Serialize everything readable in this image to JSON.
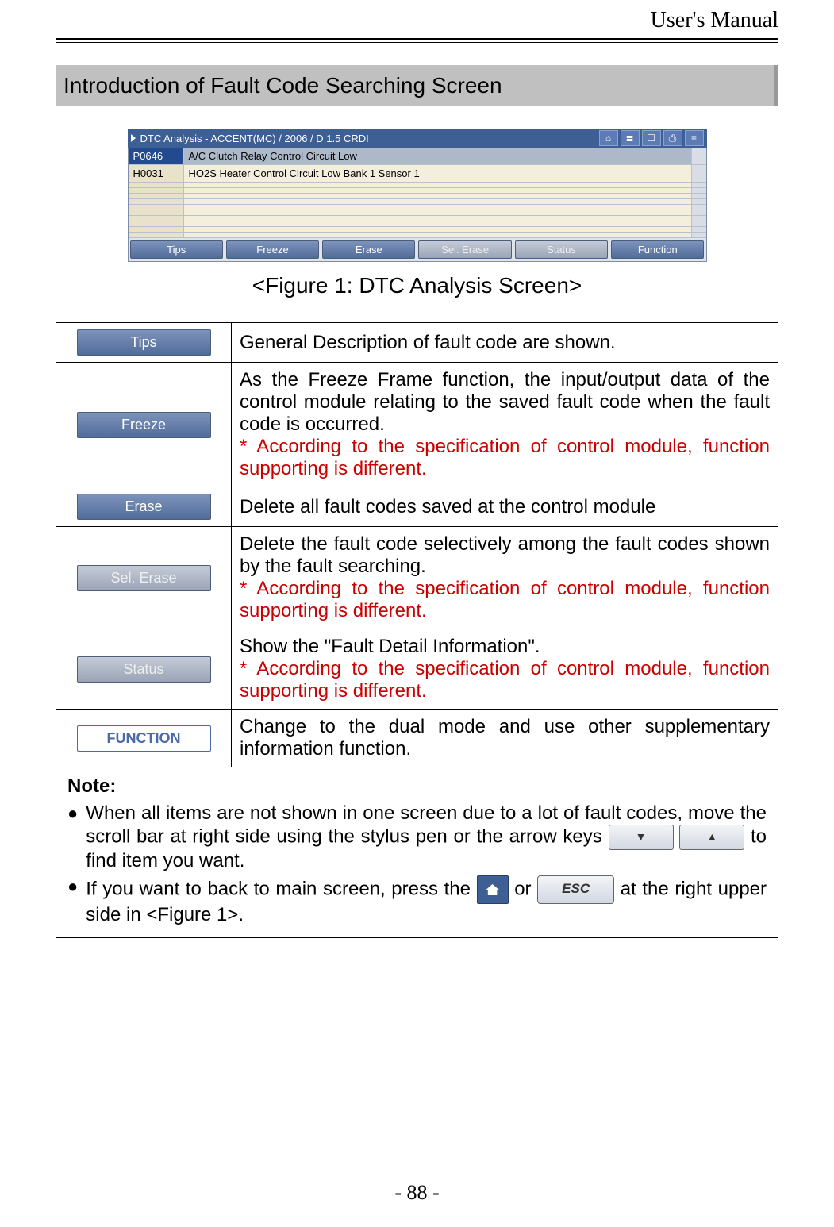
{
  "header": "User's Manual",
  "section_title": "Introduction of Fault Code Searching Screen",
  "dtc": {
    "title": "DTC Analysis - ACCENT(MC) / 2006 / D 1.5 CRDI",
    "rows": [
      {
        "code": "P0646",
        "desc": "A/C Clutch Relay Control Circuit Low",
        "selected": true
      },
      {
        "code": "H0031",
        "desc": "HO2S Heater Control Circuit Low Bank 1  Sensor 1",
        "selected": false
      }
    ],
    "footer_buttons": [
      {
        "label": "Tips",
        "disabled": false
      },
      {
        "label": "Freeze",
        "disabled": false
      },
      {
        "label": "Erase",
        "disabled": false
      },
      {
        "label": "Sel. Erase",
        "disabled": true
      },
      {
        "label": "Status",
        "disabled": true
      },
      {
        "label": "Function",
        "disabled": false
      }
    ]
  },
  "figure_caption": "<Figure 1: DTC Analysis Screen>",
  "defs": [
    {
      "btn": "Tips",
      "style": "",
      "desc": "General Description of fault code are shown.",
      "red": ""
    },
    {
      "btn": "Freeze",
      "style": "",
      "desc": "As the Freeze Frame function, the input/output data of the control module relating to the saved fault code when the fault code is occurred.",
      "red": "* According to the specification of control module, function supporting is different."
    },
    {
      "btn": "Erase",
      "style": "",
      "desc": "Delete all fault codes saved at the control module",
      "red": ""
    },
    {
      "btn": "Sel. Erase",
      "style": "dis",
      "desc": "Delete the fault code selectively among the fault codes shown by the fault searching.",
      "red": "* According to the specification of control module, function supporting is different."
    },
    {
      "btn": "Status",
      "style": "dis",
      "desc": "Show the \"Fault Detail Information\".",
      "red": "* According to the specification of control module, function supporting is different."
    },
    {
      "btn": "FUNCTION",
      "style": "outlined",
      "desc": "Change to the dual mode and use other supplementary information function.",
      "red": ""
    }
  ],
  "note_heading": "Note:",
  "note1_a": "When all items are not shown in one screen due to a lot of fault codes, move the scroll bar at right side using the stylus pen or the arrow keys ",
  "note1_b": " to find item you want.",
  "note2_a": "If you want to back to main screen, press the ",
  "note2_b": " or ",
  "note2_c": " at the right upper side in <Figure 1>.",
  "esc_label": "ESC",
  "page": "- 88 -"
}
